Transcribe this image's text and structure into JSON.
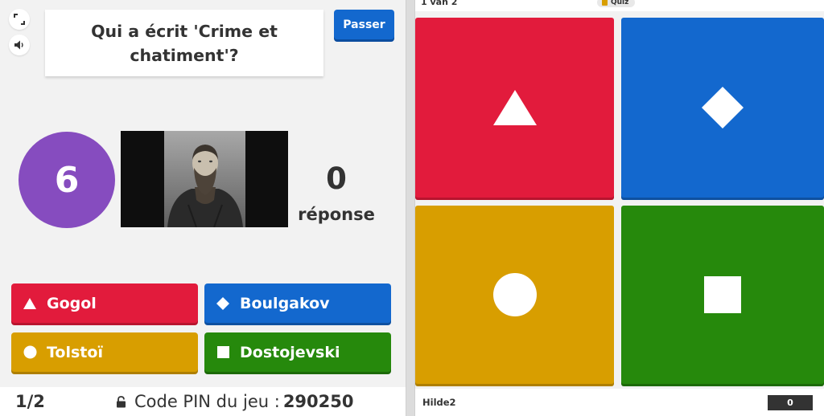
{
  "host": {
    "question": "Qui a écrit 'Crime et chatiment'?",
    "skip_label": "Passer",
    "timer": "6",
    "answer_count": "0",
    "answer_label": "réponse",
    "portrait_icon": "author-portrait",
    "answers": [
      {
        "label": "Gogol",
        "shape": "triangle",
        "color": "#e21b3c"
      },
      {
        "label": "Boulgakov",
        "shape": "diamond",
        "color": "#1368ce"
      },
      {
        "label": "Tolstoï",
        "shape": "circle",
        "color": "#d89e00"
      },
      {
        "label": "Dostojevski",
        "shape": "square",
        "color": "#26890c"
      }
    ],
    "progress": "1/2",
    "pin_label": "Code PIN du jeu :",
    "pin_value": "290250"
  },
  "player": {
    "progress": "1 van 2",
    "quiz_badge": "Quiz",
    "name": "Hilde2",
    "score": "0"
  },
  "colors": {
    "red": "#e21b3c",
    "blue": "#1368ce",
    "yellow": "#d89e00",
    "green": "#26890c",
    "purple": "#864cbf",
    "accent": "#1368ce"
  }
}
